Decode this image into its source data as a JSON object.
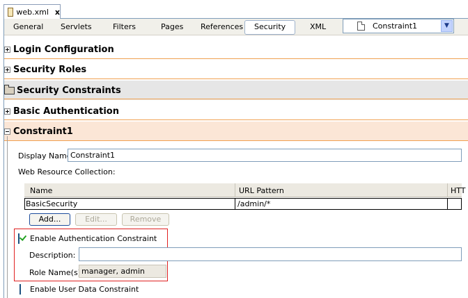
{
  "file_tab": {
    "title": "web.xml",
    "close": "x"
  },
  "toolbar": {
    "tabs": [
      "General",
      "Servlets",
      "Filters",
      "Pages",
      "References",
      "Security",
      "XML"
    ],
    "active": "Security",
    "combo_value": "Constraint1"
  },
  "sections": {
    "login": "Login Configuration",
    "roles": "Security Roles",
    "constraints": "Security Constraints",
    "basic": "Basic Authentication",
    "constraint1": "Constraint1"
  },
  "constraint1": {
    "display_name_label": "Display Name:",
    "display_name_value": "Constraint1",
    "web_resource_label": "Web Resource Collection:",
    "table": {
      "headers": [
        "Name",
        "URL Pattern",
        "HTT"
      ],
      "rows": [
        {
          "name": "BasicSecurity",
          "url": "/admin/*",
          "http": ""
        }
      ]
    },
    "buttons": {
      "add": "Add...",
      "edit": "Edit...",
      "remove": "Remove"
    },
    "auth_constraint": {
      "label": "Enable Authentication Constraint",
      "checked": true,
      "description_label": "Description:",
      "description_value": "",
      "role_names_label": "Role Name(s):",
      "role_names_value": "manager, admin"
    },
    "user_data_constraint": {
      "label": "Enable User Data Constraint",
      "checked": false
    }
  },
  "colors": {
    "section_line": "#f0a050",
    "highlight_box": "#e02020",
    "selected_section": "#fbe6d6"
  }
}
